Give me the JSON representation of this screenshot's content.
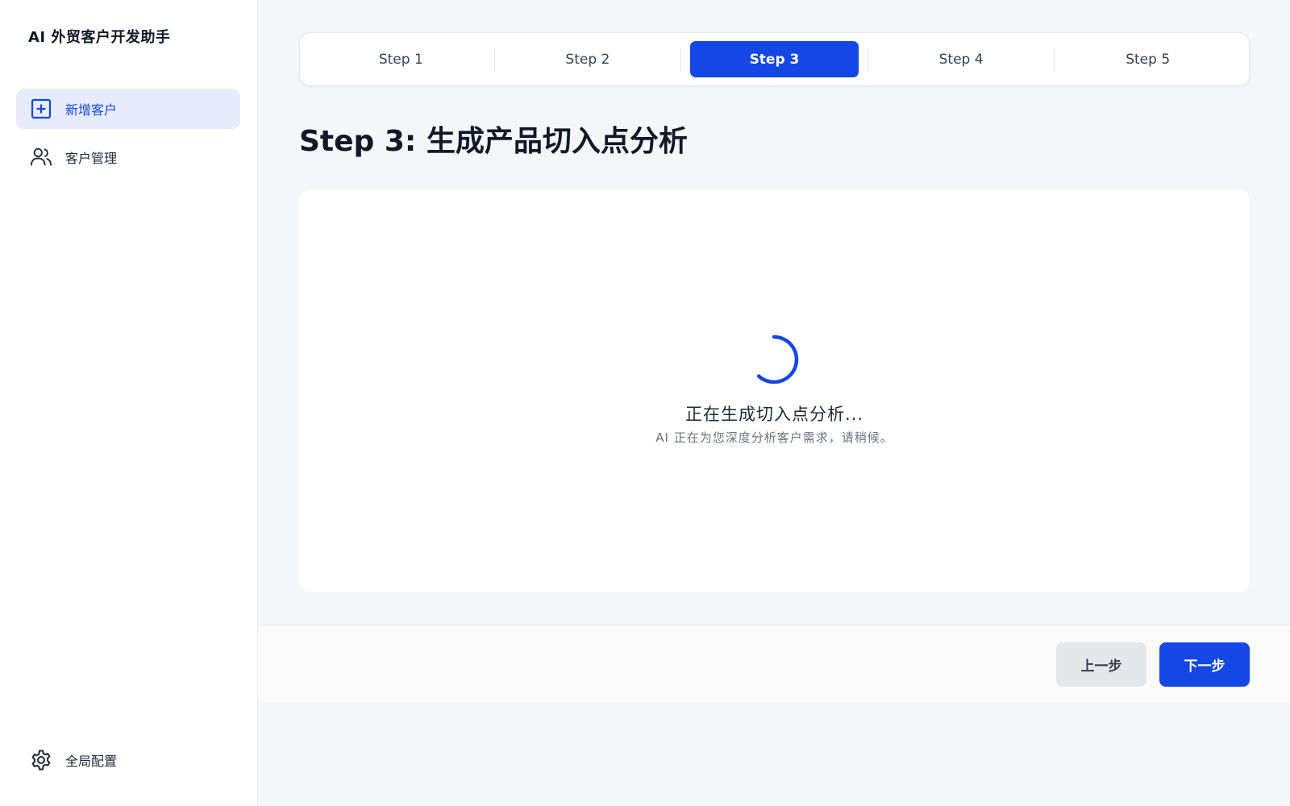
{
  "app": {
    "title": "AI 外贸客户开发助手"
  },
  "sidebar": {
    "items": [
      {
        "label": "新增客户",
        "icon": "plus-square-icon",
        "active": true
      },
      {
        "label": "客户管理",
        "icon": "users-icon",
        "active": false
      }
    ],
    "bottom": {
      "label": "全局配置",
      "icon": "gear-icon"
    }
  },
  "stepper": {
    "steps": [
      {
        "label": "Step 1",
        "active": false
      },
      {
        "label": "Step 2",
        "active": false
      },
      {
        "label": "Step 3",
        "active": true
      },
      {
        "label": "Step 4",
        "active": false
      },
      {
        "label": "Step 5",
        "active": false
      }
    ]
  },
  "main": {
    "title": "Step 3: 生成产品切入点分析",
    "loading": {
      "title": "正在生成切入点分析...",
      "subtitle": "AI 正在为您深度分析客户需求，请稍候。"
    }
  },
  "footer": {
    "prev_label": "上一步",
    "next_label": "下一步"
  },
  "colors": {
    "accent": "#1447e6",
    "active_nav_bg": "#e6ecfb",
    "page_bg": "#f5f6f8"
  }
}
